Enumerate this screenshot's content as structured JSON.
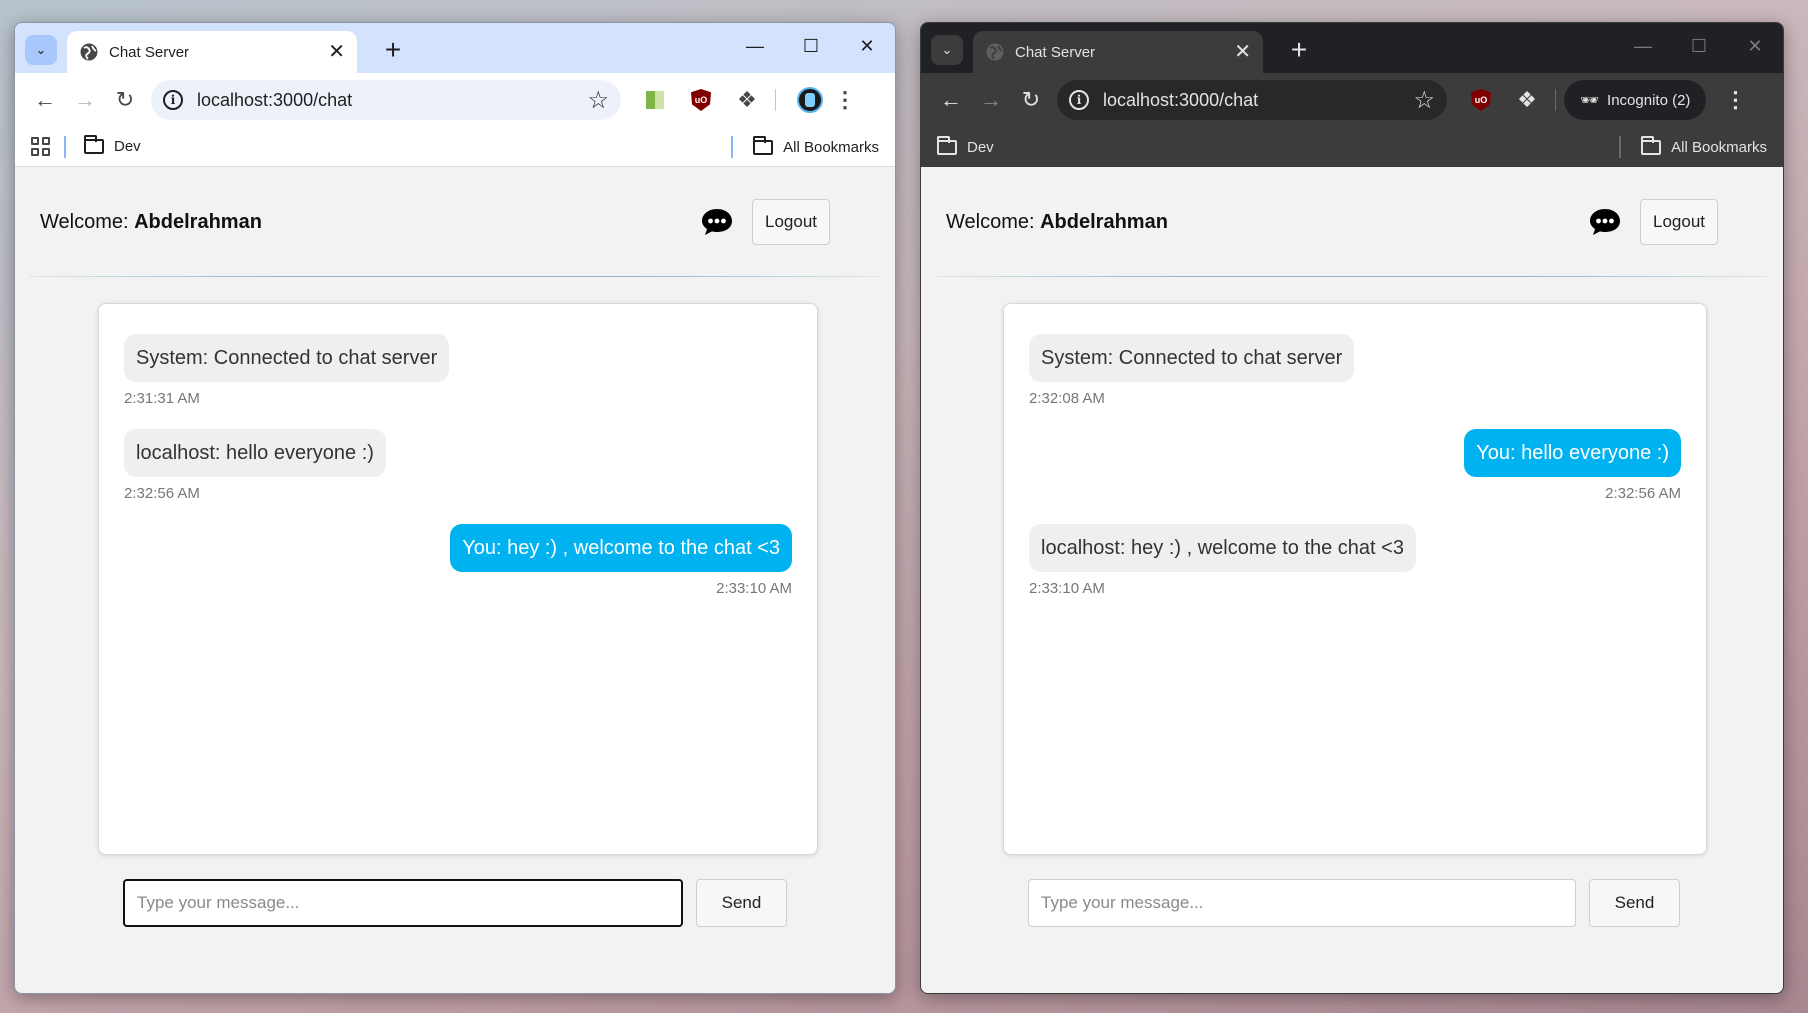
{
  "windows": [
    {
      "tab_title": "Chat Server",
      "url": "localhost:3000/chat",
      "bookmarks": {
        "folder": "Dev",
        "all": "All Bookmarks"
      },
      "welcome_label": "Welcome:",
      "username": "Abdelrahman",
      "logout_label": "Logout",
      "messages": [
        {
          "text": "System: Connected to chat server",
          "time": "2:31:31 AM",
          "side": "left"
        },
        {
          "text": "localhost: hello everyone :)",
          "time": "2:32:56 AM",
          "side": "left"
        },
        {
          "text": "You: hey :) , welcome to the chat <3",
          "time": "2:33:10 AM",
          "side": "right"
        }
      ],
      "input_placeholder": "Type your message...",
      "send_label": "Send"
    },
    {
      "tab_title": "Chat Server",
      "url": "localhost:3000/chat",
      "incognito_label": "Incognito (2)",
      "bookmarks": {
        "folder": "Dev",
        "all": "All Bookmarks"
      },
      "welcome_label": "Welcome:",
      "username": "Abdelrahman",
      "logout_label": "Logout",
      "messages": [
        {
          "text": "System: Connected to chat server",
          "time": "2:32:08 AM",
          "side": "left"
        },
        {
          "text": "You: hello everyone :)",
          "time": "2:32:56 AM",
          "side": "right"
        },
        {
          "text": "localhost: hey :) , welcome to the chat <3",
          "time": "2:33:10 AM",
          "side": "left"
        }
      ],
      "input_placeholder": "Type your message...",
      "send_label": "Send"
    }
  ],
  "colors": {
    "own_bubble": "#00b2f0",
    "other_bubble": "#efefef",
    "page_background": "#f2f2f2"
  }
}
